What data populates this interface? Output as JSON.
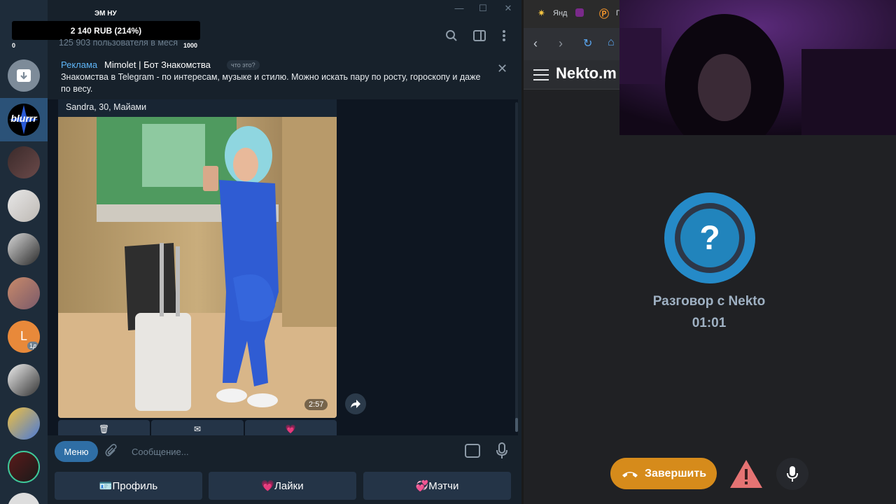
{
  "telegram": {
    "donation": {
      "title": "ЭМ НУ",
      "amount": "2 140 RUB (214%)",
      "min": "0",
      "max": "1000"
    },
    "members": "125 903 пользователя в меся",
    "ad": {
      "label": "Реклама",
      "name": "Mimolet | Бот Знакомства",
      "what": "что это?",
      "text": "Знакомства в Telegram - по интересам, музыке и стилю. Можно искать пару по росту, гороскопу и даже по весу."
    },
    "active_folder_label": "blurrr",
    "avatar_badge": "1д",
    "avatar_letter": "L",
    "message": {
      "caption": "Sandra, 30, Майами",
      "duration": "2:57",
      "inline_buttons": [
        "🗑",
        "✉",
        "💗"
      ]
    },
    "composer": {
      "menu": "Меню",
      "placeholder": "Сообщение..."
    },
    "reply_keyboard": [
      "🪪Профиль",
      "💗Лайки",
      "💞Мэтчи"
    ]
  },
  "browser": {
    "tabs": [
      "Янд",
      "П"
    ],
    "site_title": "Nekto.m",
    "conversation_title": "Разговор с Nekto",
    "timer": "01:01",
    "end_button": "Завершить"
  }
}
